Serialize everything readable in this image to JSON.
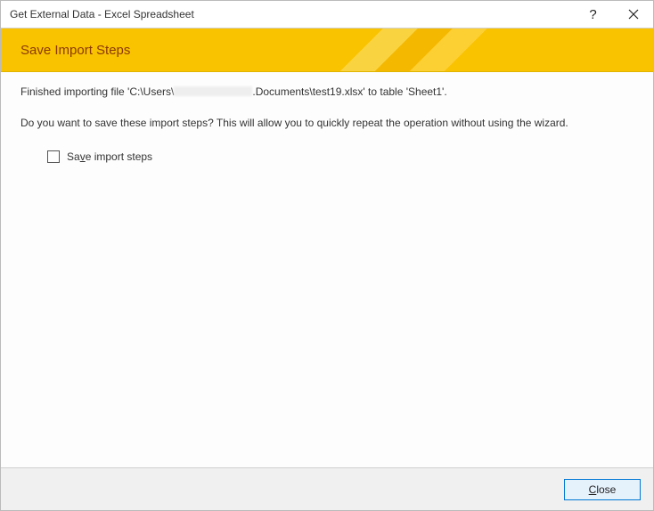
{
  "titlebar": {
    "title": "Get External Data - Excel Spreadsheet",
    "help": "?",
    "close": "✕"
  },
  "banner": {
    "heading": "Save Import Steps"
  },
  "body": {
    "finished_prefix": "Finished importing file 'C:\\Users\\",
    "finished_suffix": ".Documents\\test19.xlsx' to table 'Sheet1'.",
    "prompt": "Do you want to save these import steps? This will allow you to quickly repeat the operation without using the wizard.",
    "checkbox_prefix": "Sa",
    "checkbox_accel": "v",
    "checkbox_suffix": "e import steps"
  },
  "footer": {
    "close_accel": "C",
    "close_rest": "lose"
  }
}
